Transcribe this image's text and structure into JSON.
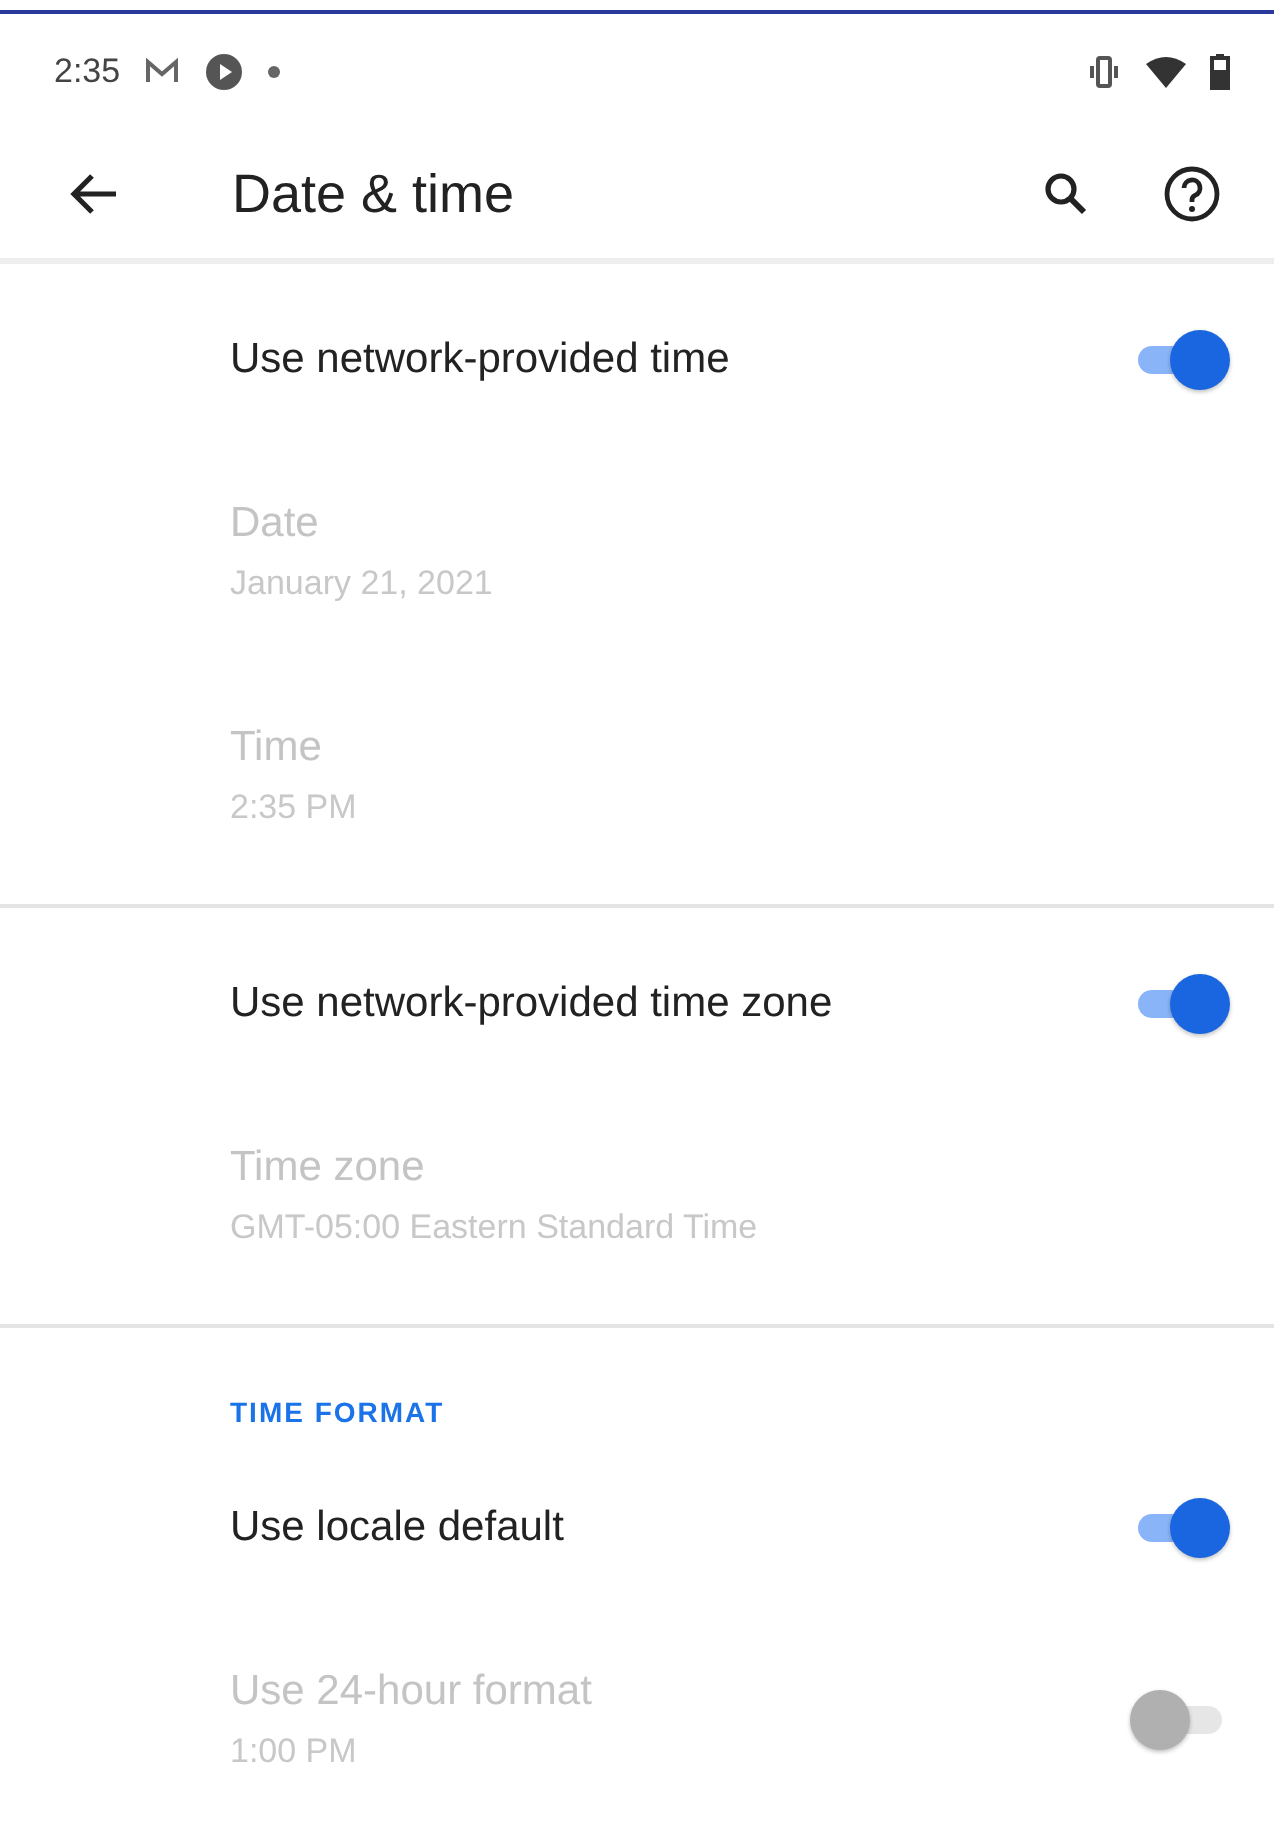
{
  "status_bar": {
    "time": "2:35"
  },
  "toolbar": {
    "title": "Date & time"
  },
  "sections": [
    {
      "items": [
        {
          "kind": "toggle",
          "title": "Use network-provided time",
          "on": true,
          "disabled": false
        },
        {
          "kind": "detail",
          "title": "Date",
          "summary": "January 21, 2021",
          "disabled": true
        },
        {
          "kind": "detail",
          "title": "Time",
          "summary": "2:35 PM",
          "disabled": true
        }
      ]
    },
    {
      "items": [
        {
          "kind": "toggle",
          "title": "Use network-provided time zone",
          "on": true,
          "disabled": false
        },
        {
          "kind": "detail",
          "title": "Time zone",
          "summary": "GMT-05:00 Eastern Standard Time",
          "disabled": true
        }
      ]
    },
    {
      "header": "TIME FORMAT",
      "items": [
        {
          "kind": "toggle",
          "title": "Use locale default",
          "on": true,
          "disabled": false
        },
        {
          "kind": "toggle",
          "title": "Use 24-hour format",
          "summary": "1:00 PM",
          "on": false,
          "disabled": true
        }
      ]
    }
  ]
}
